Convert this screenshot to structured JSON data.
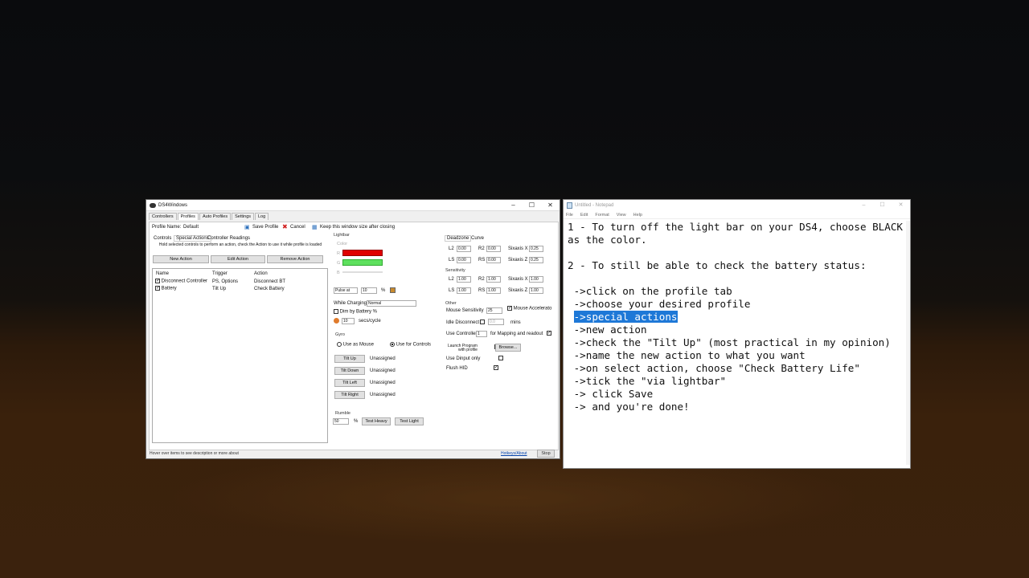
{
  "ds4": {
    "title": "DS4Windows",
    "tabs": [
      "Controllers",
      "Profiles",
      "Auto Profiles",
      "Settings",
      "Log"
    ],
    "profile_name_label": "Profile Name:",
    "profile_name_value": "Default",
    "save_profile": "Save Profile",
    "cancel": "Cancel",
    "keep_window_size": "Keep this window size after closing",
    "subtabs": [
      "Controls",
      "Special Actions",
      "Controller Readings"
    ],
    "hint": "Hold selected controls to perform an action, check the Action to use it while profile is loaded",
    "new_action": "New Action",
    "edit_action": "Edit Action",
    "remove_action": "Remove Action",
    "columns": [
      "Name",
      "Trigger",
      "Action"
    ],
    "actions": [
      {
        "name": "Disconnect Controller",
        "trigger": "PS, Options",
        "action": "Disconnect BT"
      },
      {
        "name": "Battery",
        "trigger": "Tilt Up",
        "action": "Check Battery"
      }
    ],
    "lightbar": {
      "label": "Lightbar",
      "color_label": "Color",
      "r": "R",
      "g": "G",
      "b": "B",
      "mode": "Pulse at",
      "mode_value": "10",
      "percent": "%",
      "while_charging": "While Charging",
      "charging_value": "Normal",
      "dim_by_battery": "Dim by Battery %",
      "secs_value": "10",
      "secs_label": "secs/cycle",
      "red": "#e00000",
      "green": "#5ee05e"
    },
    "gyro": {
      "label": "Gyro",
      "use_as_mouse": "Use as Mouse",
      "use_for_controls": "Use for Controls",
      "rows": [
        {
          "btn": "Tilt Up",
          "val": "Unassigned"
        },
        {
          "btn": "Tilt Down",
          "val": "Unassigned"
        },
        {
          "btn": "Tilt Left",
          "val": "Unassigned"
        },
        {
          "btn": "Tilt Right",
          "val": "Unassigned"
        }
      ]
    },
    "rumble": {
      "label": "Rumble",
      "value": "50",
      "percent": "%",
      "test_heavy": "Test Heavy",
      "test_light": "Test Light"
    },
    "deadzone": {
      "tabs": [
        "Deadzone",
        "Curve"
      ],
      "l2": "L2",
      "l2_val": "0.00",
      "r2": "R2",
      "r2_val": "0.00",
      "sixaxis_x": "Sixaxis X",
      "sx_val": "0.25",
      "ls": "LS",
      "ls_val": "0.00",
      "rs": "RS",
      "rs_val": "0.00",
      "sixaxis_z": "Sixaxis Z",
      "sz_val": "0.25"
    },
    "sensitivity": {
      "label": "Sensitivity",
      "l2": "L2",
      "l2_val": "1.00",
      "r2": "R2",
      "r2_val": "1.00",
      "sixaxis_x": "Sixaxis X",
      "sx_val": "1.00",
      "ls": "LS",
      "ls_val": "1.00",
      "rs": "RS",
      "rs_val": "1.00",
      "sixaxis_z": "Sixaxis Z",
      "sz_val": "1.00"
    },
    "other": {
      "label": "Other",
      "mouse_sensitivity": "Mouse Sensitivity",
      "mouse_sens_val": "25",
      "mouse_accel": "Mouse Accelerato",
      "idle_disconnect": "Idle Disconnect",
      "idle_val": "0.0",
      "mins": "mins",
      "use_controller": "Use Controller",
      "use_controller_val": "1",
      "mapping_readout": "for Mapping and readout",
      "launch_program": "Launch Program",
      "with_profile": "with profile",
      "browse": "Browse...",
      "use_dinput": "Use Dinput only",
      "flush_hid": "Flush HID"
    },
    "status": "Hover over items to see description or more about",
    "hotkeys": "Hotkeys/About",
    "stop": "Stop"
  },
  "notepad": {
    "title": "Untitled - Notepad",
    "menu": [
      "File",
      "Edit",
      "Format",
      "View",
      "Help"
    ],
    "lines": [
      "1 - To turn off the light bar on your DS4, choose BLACK",
      "as the color.",
      "",
      "2 - To still be able to check the battery status:",
      "",
      " ->click on the profile tab",
      " ->choose your desired profile",
      "",
      " ->new action",
      " ->check the \"Tilt Up\" (most practical in my opinion)",
      " ->name the new action to what you want",
      " ->on select action, choose \"Check Battery Life\"",
      " ->tick the \"via lightbar\"",
      " -> click Save",
      " -> and you're done!"
    ],
    "highlight_indent": " ",
    "highlighted": "->special actions"
  }
}
